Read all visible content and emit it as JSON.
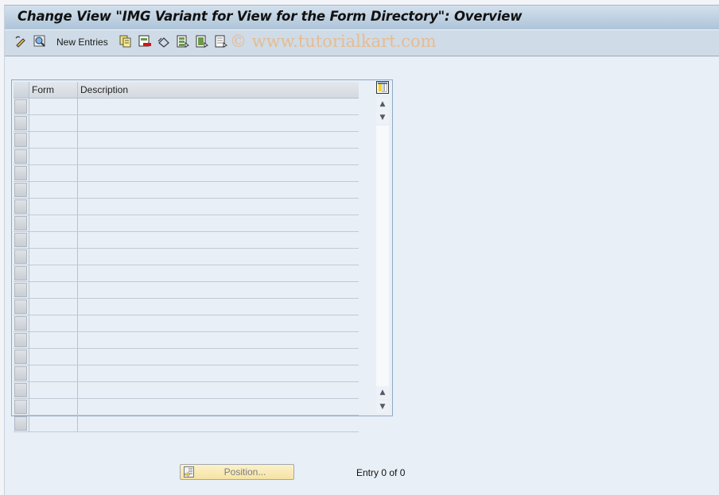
{
  "window": {
    "title": "Change View \"IMG Variant for View for the Form Directory\": Overview"
  },
  "toolbar": {
    "items": [
      {
        "icon": "display-change-icon"
      },
      {
        "icon": "find-icon"
      },
      {
        "label": "New Entries"
      },
      {
        "icon": "copy-as-icon"
      },
      {
        "icon": "delete-icon"
      },
      {
        "icon": "undo-change-icon"
      },
      {
        "icon": "select-all-icon"
      },
      {
        "icon": "select-block-icon"
      },
      {
        "icon": "deselect-all-icon"
      }
    ],
    "new_entries_label": "New Entries",
    "watermark": "© www.tutorialkart.com"
  },
  "table": {
    "columns": [
      "Form",
      "Description"
    ],
    "rows": [
      [
        "",
        ""
      ],
      [
        "",
        ""
      ],
      [
        "",
        ""
      ],
      [
        "",
        ""
      ],
      [
        "",
        ""
      ],
      [
        "",
        ""
      ],
      [
        "",
        ""
      ],
      [
        "",
        ""
      ],
      [
        "",
        ""
      ],
      [
        "",
        ""
      ],
      [
        "",
        ""
      ],
      [
        "",
        ""
      ],
      [
        "",
        ""
      ],
      [
        "",
        ""
      ],
      [
        "",
        ""
      ],
      [
        "",
        ""
      ],
      [
        "",
        ""
      ],
      [
        "",
        ""
      ],
      [
        "",
        ""
      ],
      [
        "",
        ""
      ]
    ]
  },
  "footer": {
    "position_label": "Position...",
    "entry_text": "Entry 0 of 0"
  }
}
